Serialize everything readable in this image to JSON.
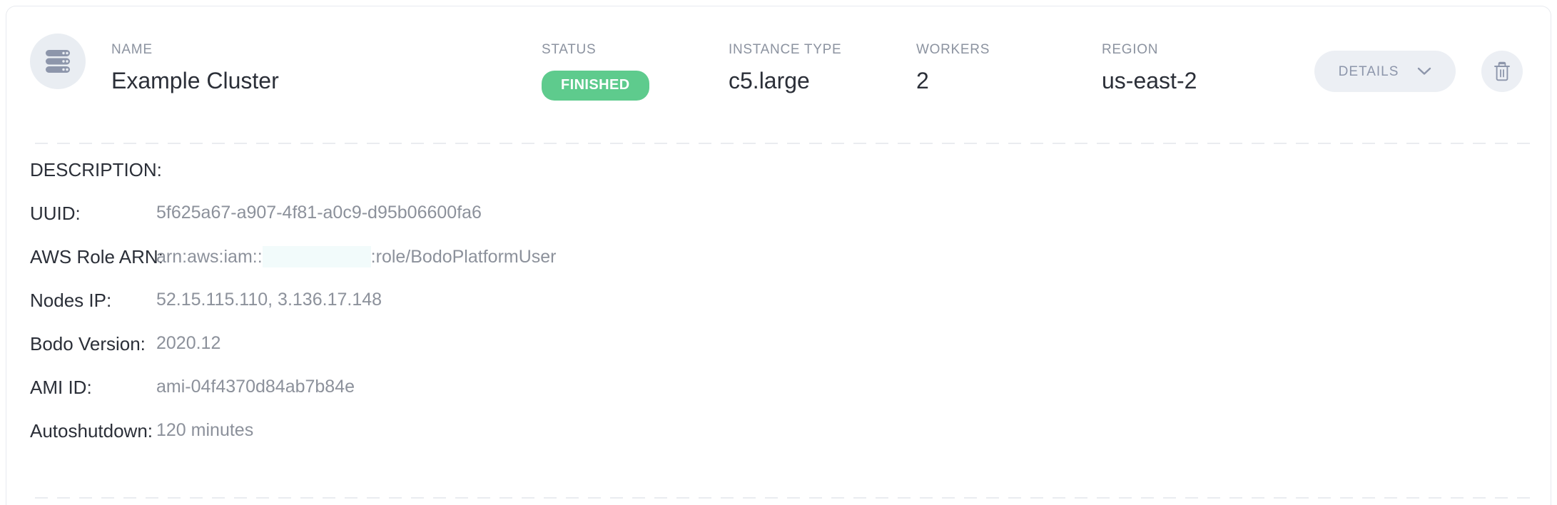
{
  "header": {
    "avatar_icon": "server-cluster-icon",
    "columns": [
      {
        "label": "NAME",
        "value": "Example Cluster"
      },
      {
        "label": "STATUS",
        "value": "FINISHED"
      },
      {
        "label": "INSTANCE TYPE",
        "value": "c5.large"
      },
      {
        "label": "WORKERS",
        "value": "2"
      },
      {
        "label": "REGION",
        "value": "us-east-2"
      }
    ],
    "details_button": {
      "label": "DETAILS",
      "chevron_icon": "chevron-down-icon"
    },
    "delete_button": {
      "icon": "trash-icon"
    }
  },
  "details": {
    "rows": [
      {
        "key": "DESCRIPTION:",
        "value": ""
      },
      {
        "key": "UUID:",
        "value": "5f625a67-a907-4f81-a0c9-d95b06600fa6"
      },
      {
        "key": "AWS Role ARN:",
        "value_prefix": "arn:aws:iam::",
        "value_redacted": true,
        "value_suffix": ":role/BodoPlatformUser"
      },
      {
        "key": "Nodes IP:",
        "value": "52.15.115.110, 3.136.17.148"
      },
      {
        "key": "Bodo Version:",
        "value": "2020.12"
      },
      {
        "key": "AMI ID:",
        "value": "ami-04f4370d84ab7b84e"
      },
      {
        "key": "Autoshutdown:",
        "value": "120 minutes"
      }
    ]
  },
  "colors": {
    "status_finished": "#5ecb8d",
    "card_border": "#e8eaef",
    "avatar_bg": "#e9edf2",
    "icon_slate": "#8d96ab",
    "label_gray": "#8c93a0",
    "value_gray": "#8c919b",
    "text_dark": "#2b2f38",
    "button_bg": "#eceff4",
    "redaction_bg": "#f2fbfb"
  }
}
